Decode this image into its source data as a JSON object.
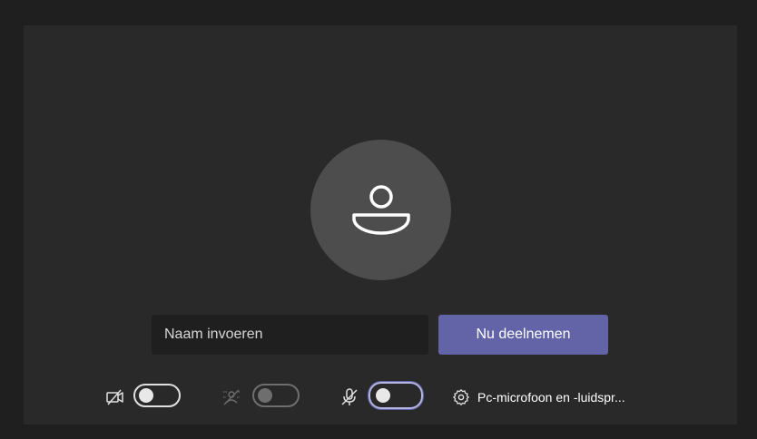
{
  "prejoin": {
    "name_input": {
      "placeholder": "Naam invoeren",
      "value": ""
    },
    "join_button_label": "Nu deelnemen"
  },
  "controls": {
    "camera": {
      "icon": "camera-off-icon",
      "state": "off"
    },
    "background_effects": {
      "icon": "background-blur-icon",
      "state": "off",
      "enabled": false
    },
    "microphone": {
      "icon": "mic-off-icon",
      "state": "off"
    },
    "device_settings": {
      "icon": "gear-icon",
      "label": "Pc-microfoon en -luidspr..."
    }
  },
  "colors": {
    "outer_background": "#1f1f1f",
    "panel_background": "#292929",
    "avatar_background": "#4d4d4d",
    "accent": "#6264a7",
    "text": "#ffffff"
  }
}
